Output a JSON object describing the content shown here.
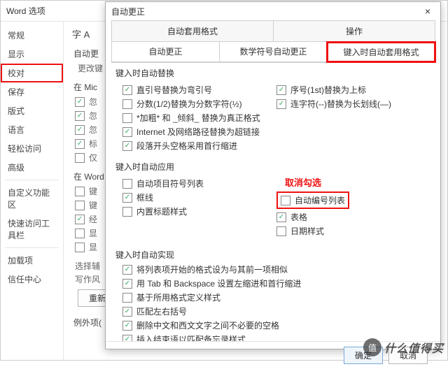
{
  "window": {
    "title": "Word 选项",
    "btn_help": "?",
    "btn_close": "×"
  },
  "sidebar": {
    "items": [
      "常规",
      "显示",
      "校对",
      "保存",
      "版式",
      "语言",
      "轻松访问",
      "高级"
    ],
    "items2": [
      "自定义功能区",
      "快速访问工具栏"
    ],
    "items3": [
      "加载项",
      "信任中心"
    ],
    "highlight_index": 2
  },
  "main": {
    "heading": "字 A",
    "r1": "自动更",
    "r2": "更改键",
    "g1": "在 Mic",
    "g1rows": [
      "忽",
      "忽",
      "忽",
      "标",
      "仅"
    ],
    "g2": "在 Word",
    "g2rows": [
      "键",
      "键",
      "经",
      "显",
      "显"
    ],
    "sel": "选择辅",
    "sel2": "写作风",
    "reset": "重新",
    "exc": "例外项("
  },
  "dialog": {
    "title": "自动更正",
    "close": "×",
    "tabs1": [
      "自动套用格式",
      "操作"
    ],
    "tabs2": [
      "自动更正",
      "数学符号自动更正",
      "键入时自动套用格式"
    ],
    "sec1": "键入时自动替换",
    "s1_left": [
      "直引号替换为弯引号",
      "分数(1/2)替换为分数字符(½)",
      "*加粗* 和 _倾斜_ 替换为真正格式",
      "Internet 及网络路径替换为超链接",
      "段落开头空格采用首行缩进"
    ],
    "s1_right": [
      "序号(1st)替换为上标",
      "连字符(--)替换为长划线(—)"
    ],
    "sec2": "键入时自动应用",
    "s2_left": [
      "自动项目符号列表",
      "框线",
      "内置标题样式"
    ],
    "s2_left_chk": [
      false,
      true,
      false
    ],
    "s2_right_note": "取消勾选",
    "s2_right": [
      "自动编号列表",
      "表格",
      "日期样式"
    ],
    "s2_right_chk": [
      false,
      true,
      false
    ],
    "sec3": "键入时自动实现",
    "s3": [
      "将列表项开始的格式设为与其前一项相似",
      "用 Tab 和 Backspace 设置左缩进和首行缩进",
      "基于所用格式定义样式",
      "匹配左右括号",
      "删除中文和西文文字之间不必要的空格",
      "插入结束语以匹配备忘录样式"
    ],
    "s3_chk": [
      true,
      true,
      false,
      true,
      true,
      true
    ],
    "ok": "确定",
    "cancel": "取消"
  },
  "watermark": {
    "badge": "值",
    "text": "什么值得买"
  }
}
